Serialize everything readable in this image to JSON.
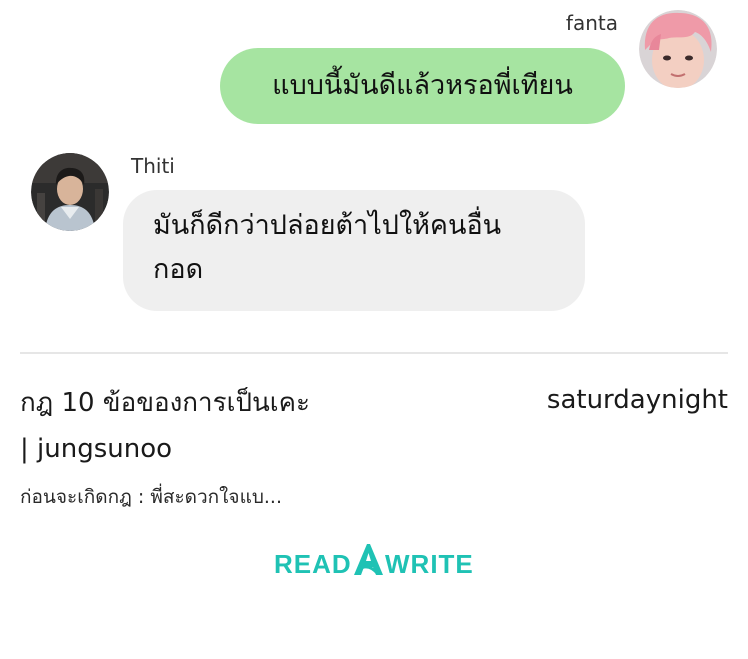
{
  "chat": {
    "messages": [
      {
        "sender": "fanta",
        "side": "right",
        "text": "แบบนี้มันดีแล้วหรอพี่เทียน",
        "bubble_color": "#a6e4a1"
      },
      {
        "sender": "Thiti",
        "side": "left",
        "text": "มันก็ดีกว่าปล่อยต้าไปให้คนอื่น กอด",
        "line1": "มันก็ดีกว่าปล่อยต้าไปให้คนอื่น",
        "line2": "กอด",
        "bubble_color": "#efefef"
      }
    ]
  },
  "story": {
    "title_line1": "กฎ 10 ข้อของการเป็นเคะ",
    "title_line2": "| jungsunoo",
    "author": "saturdaynight",
    "excerpt": "ก่อนจะเกิดกฎ : พี่สะดวกใจแบ..."
  },
  "brand": {
    "logo_text": "READAWRITE",
    "color": "#1fc2b4"
  },
  "icons": {
    "avatar_fanta": "avatar-pink-hair-icon",
    "avatar_thiti": "avatar-man-portrait-icon"
  }
}
